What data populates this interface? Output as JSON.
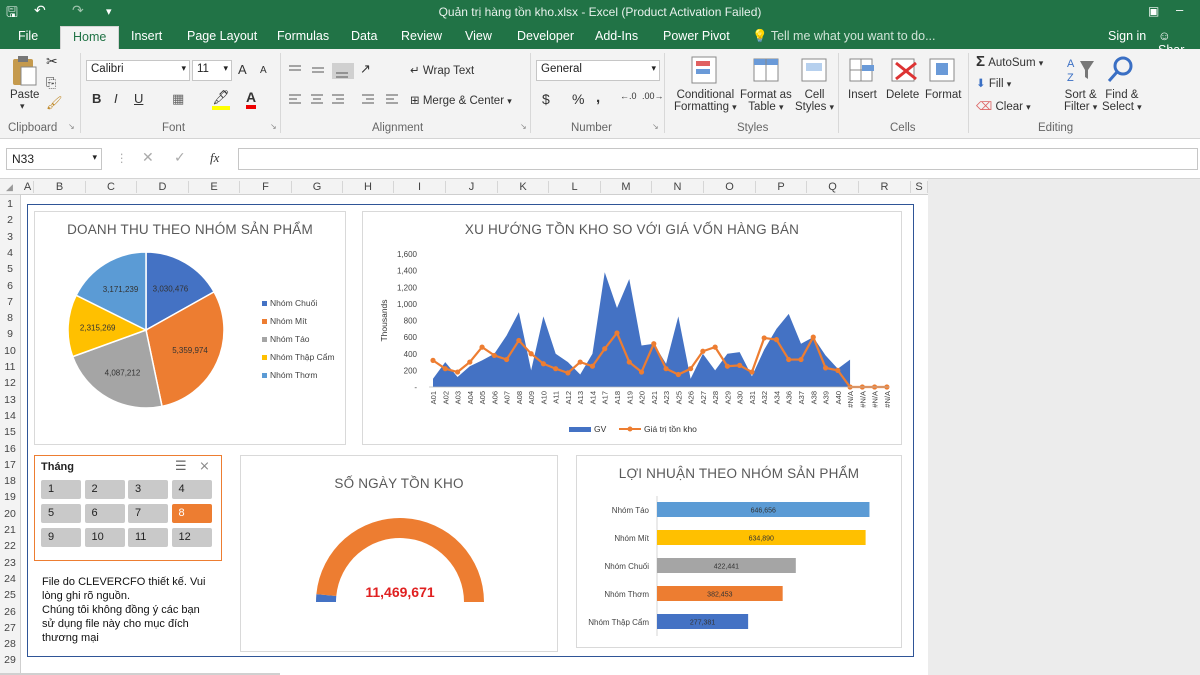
{
  "window": {
    "title": "Quản trị hàng tồn kho.xlsx - Excel (Product Activation Failed)"
  },
  "tabs": [
    "File",
    "Home",
    "Insert",
    "Page Layout",
    "Formulas",
    "Data",
    "Review",
    "View",
    "Developer",
    "Add-Ins",
    "Power Pivot"
  ],
  "tell_me": "Tell me what you want to do...",
  "sign_in": "Sign in",
  "share": "Shar",
  "ribbon": {
    "clipboard": {
      "label": "Clipboard",
      "paste": "Paste"
    },
    "font": {
      "label": "Font",
      "name": "Calibri",
      "size": "11",
      "bold": "B",
      "italic": "I",
      "underline": "U",
      "grow": "A",
      "shrink": "A"
    },
    "alignment": {
      "label": "Alignment",
      "wrap": "Wrap Text",
      "merge": "Merge & Center"
    },
    "number": {
      "label": "Number",
      "format": "General",
      "currency": "$",
      "percent": "%",
      "comma": ","
    },
    "styles": {
      "label": "Styles",
      "conditional": "Conditional",
      "conditional2": "Formatting",
      "format_as": "Format as",
      "table": "Table",
      "cell": "Cell",
      "cell2": "Styles"
    },
    "cells": {
      "label": "Cells",
      "insert": "Insert",
      "delete": "Delete",
      "format": "Format"
    },
    "editing": {
      "label": "Editing",
      "autosum": "AutoSum",
      "fill": "Fill",
      "clear": "Clear",
      "sort": "Sort &",
      "filter": "Filter",
      "find": "Find &",
      "select": "Select"
    }
  },
  "formula_bar": {
    "name_box": "N33",
    "fx": "fx"
  },
  "columns": [
    "A",
    "B",
    "C",
    "D",
    "E",
    "F",
    "G",
    "H",
    "I",
    "J",
    "K",
    "L",
    "M",
    "N",
    "O",
    "P",
    "Q",
    "R",
    "S"
  ],
  "rows": [
    "1",
    "2",
    "3",
    "4",
    "5",
    "6",
    "7",
    "8",
    "9",
    "10",
    "11",
    "12",
    "13",
    "14",
    "15",
    "16",
    "17",
    "18",
    "19",
    "20",
    "21",
    "22",
    "23",
    "24",
    "25",
    "26",
    "27",
    "28",
    "29"
  ],
  "colors": {
    "excel_green": "#217346",
    "blue": "#4472c4",
    "orange": "#ed7d31",
    "gray": "#a5a5a5",
    "yellow": "#ffc000",
    "lightblue": "#5b9bd5"
  },
  "pie": {
    "title": "DOANH THU THEO NHÓM SẢN PHẨM",
    "chart_data": {
      "type": "pie",
      "slices": [
        {
          "name": "Nhóm Chuối",
          "value": 3030476,
          "label": "3,030,476",
          "color": "#4472c4"
        },
        {
          "name": "Nhóm Mít",
          "value": 5359974,
          "label": "5,359,974",
          "color": "#ed7d31"
        },
        {
          "name": "Nhóm Táo",
          "value": 4087212,
          "label": "4,087,212",
          "color": "#a5a5a5"
        },
        {
          "name": "Nhóm Thập Cẩm",
          "value": 2315269,
          "label": "2,315,269",
          "color": "#ffc000"
        },
        {
          "name": "Nhóm Thơm",
          "value": 3171239,
          "label": "3,171,239",
          "color": "#5b9bd5"
        }
      ]
    }
  },
  "trend": {
    "title": "XU HƯỚNG TỒN KHO SO VỚI GIÁ VỐN HÀNG BÁN",
    "chart_data": {
      "type": "area",
      "ylabel": "Thousands",
      "ylim": [
        0,
        1600
      ],
      "yticks": [
        "-",
        "200",
        "400",
        "600",
        "800",
        "1,000",
        "1,200",
        "1,400",
        "1,600"
      ],
      "categories": [
        "A01",
        "A02",
        "A03",
        "A04",
        "A05",
        "A06",
        "A07",
        "A08",
        "A09",
        "A10",
        "A11",
        "A12",
        "A13",
        "A14",
        "A17",
        "A18",
        "A19",
        "A20",
        "A21",
        "A23",
        "A25",
        "A26",
        "A27",
        "A28",
        "A29",
        "A30",
        "A31",
        "A32",
        "A34",
        "A36",
        "A37",
        "A38",
        "A39",
        "A40",
        "#N/A",
        "#N/A",
        "#N/A",
        "#N/A"
      ],
      "series": [
        {
          "name": "GV",
          "type": "area",
          "color": "#4472c4",
          "values": [
            100,
            300,
            120,
            250,
            320,
            400,
            620,
            900,
            200,
            850,
            400,
            300,
            150,
            400,
            1380,
            950,
            1300,
            500,
            520,
            280,
            850,
            100,
            400,
            200,
            400,
            420,
            130,
            450,
            700,
            880,
            520,
            600,
            380,
            220,
            330,
            null,
            null,
            null
          ]
        },
        {
          "name": "Giá trị tồn kho",
          "type": "line",
          "color": "#ed7d31",
          "values": [
            320,
            220,
            180,
            300,
            480,
            380,
            330,
            560,
            400,
            280,
            220,
            170,
            300,
            250,
            460,
            650,
            300,
            180,
            520,
            220,
            150,
            220,
            430,
            480,
            250,
            260,
            180,
            590,
            570,
            330,
            330,
            600,
            230,
            200,
            0,
            0,
            0,
            0
          ]
        }
      ]
    }
  },
  "slicer": {
    "title": "Tháng",
    "items": [
      "1",
      "2",
      "3",
      "4",
      "5",
      "6",
      "7",
      "8",
      "9",
      "10",
      "11",
      "12"
    ],
    "selected": "8"
  },
  "note": {
    "l1": "File do CLEVERCFO thiết kế. Vui",
    "l2": "lòng ghi rõ nguồn.",
    "l3": "Chúng tôi không đồng ý các bạn",
    "l4": "sử dụng file này cho mục đích",
    "l5": "thương mại"
  },
  "gauge": {
    "title": "SỐ NGÀY TỒN KHO",
    "value": "11,469,671",
    "fill_fraction": 0.97,
    "colors": {
      "main": "#ed7d31",
      "rest": "#4472c4"
    }
  },
  "profit": {
    "title": "LỢI NHUẬN THEO NHÓM SẢN PHẨM",
    "chart_data": {
      "type": "bar",
      "orientation": "horizontal",
      "xlim": [
        0,
        700000
      ],
      "bars": [
        {
          "name": "Nhóm Táo",
          "value": 646656,
          "label": "646,656",
          "color": "#5b9bd5"
        },
        {
          "name": "Nhóm Mít",
          "value": 634890,
          "label": "634,890",
          "color": "#ffc000"
        },
        {
          "name": "Nhóm Chuối",
          "value": 422441,
          "label": "422,441",
          "color": "#a5a5a5"
        },
        {
          "name": "Nhóm Thơm",
          "value": 382453,
          "label": "382,453",
          "color": "#ed7d31"
        },
        {
          "name": "Nhóm Thập Cẩm",
          "value": 277381,
          "label": "277,381",
          "color": "#4472c4"
        }
      ]
    }
  }
}
